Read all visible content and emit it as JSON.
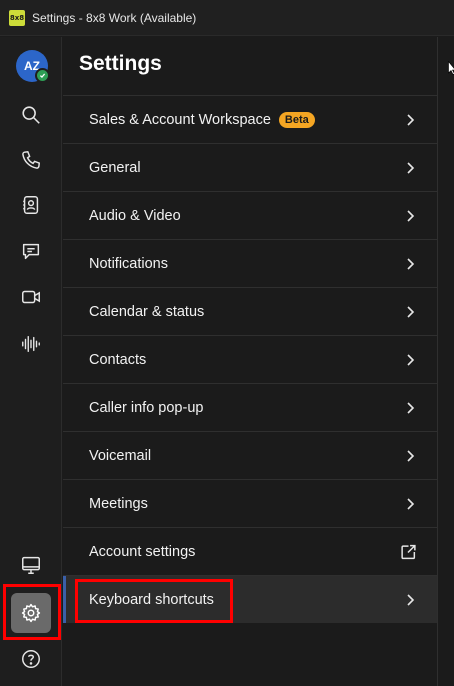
{
  "window": {
    "title": "Settings - 8x8 Work (Available)",
    "logo_text": "8x8"
  },
  "rail": {
    "avatar_initials": "AZ",
    "items": [
      {
        "name": "search",
        "icon": "search-icon"
      },
      {
        "name": "calls",
        "icon": "phone-icon"
      },
      {
        "name": "contacts",
        "icon": "contact-card-icon"
      },
      {
        "name": "messages",
        "icon": "chat-icon"
      },
      {
        "name": "meetings",
        "icon": "video-camera-icon"
      },
      {
        "name": "voice",
        "icon": "waveform-icon"
      }
    ],
    "bottom_items": [
      {
        "name": "desktop",
        "icon": "monitor-icon"
      },
      {
        "name": "settings",
        "icon": "gear-icon",
        "active": true
      },
      {
        "name": "help",
        "icon": "help-icon"
      }
    ]
  },
  "settings": {
    "title": "Settings",
    "items": [
      {
        "label": "Sales & Account Workspace",
        "badge": "Beta",
        "trailing": "chevron"
      },
      {
        "label": "General",
        "trailing": "chevron"
      },
      {
        "label": "Audio & Video",
        "trailing": "chevron"
      },
      {
        "label": "Notifications",
        "trailing": "chevron"
      },
      {
        "label": "Calendar & status",
        "trailing": "chevron"
      },
      {
        "label": "Contacts",
        "trailing": "chevron"
      },
      {
        "label": "Caller info pop-up",
        "trailing": "chevron"
      },
      {
        "label": "Voicemail",
        "trailing": "chevron"
      },
      {
        "label": "Meetings",
        "trailing": "chevron"
      },
      {
        "label": "Account settings",
        "trailing": "external-link"
      },
      {
        "label": "Keyboard shortcuts",
        "trailing": "chevron",
        "selected": true
      }
    ]
  },
  "colors": {
    "background": "#1b1b1b",
    "highlight": "#ff0000",
    "beta_badge": "#f5a623",
    "avatar": "#2c66c9",
    "presence_available": "#2e9e55"
  }
}
